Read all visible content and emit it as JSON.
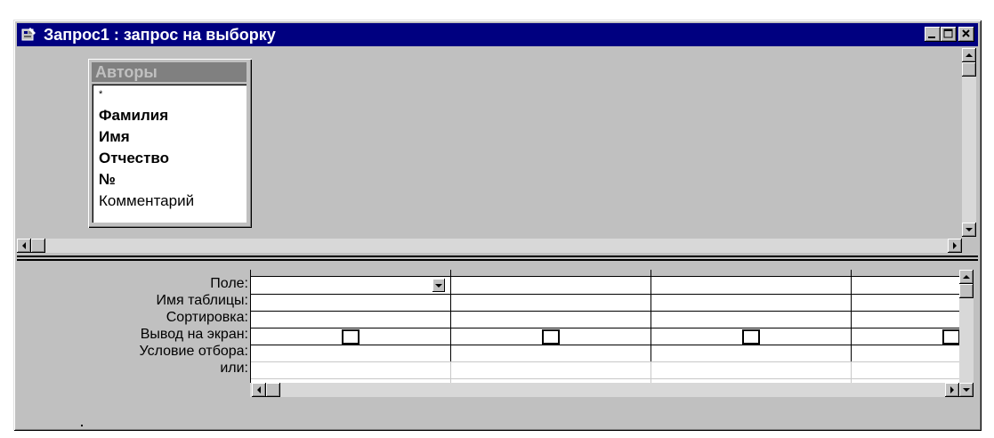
{
  "window": {
    "title": "Запрос1 : запрос на выборку",
    "controls": [
      "minimize-icon",
      "maximize-icon",
      "close-icon"
    ],
    "title_bar_color": "#000080"
  },
  "field_list": {
    "title": "Авторы",
    "items": [
      {
        "label": "*",
        "bold": false
      },
      {
        "label": "Фамилия",
        "bold": true
      },
      {
        "label": "Имя",
        "bold": true
      },
      {
        "label": "Отчество",
        "bold": true
      },
      {
        "label": "№",
        "bold": true
      },
      {
        "label": "Комментарий",
        "bold": false
      }
    ]
  },
  "query_grid": {
    "row_labels": [
      "Поле:",
      "Имя таблицы:",
      "Сортировка:",
      "Вывод на экран:",
      "Условие отбора:",
      "или:"
    ],
    "columns": [
      {
        "field": "",
        "table": "",
        "sort": "",
        "show": false,
        "criteria": "",
        "or": ""
      },
      {
        "field": "",
        "table": "",
        "sort": "",
        "show": false,
        "criteria": "",
        "or": ""
      },
      {
        "field": "",
        "table": "",
        "sort": "",
        "show": false,
        "criteria": "",
        "or": ""
      },
      {
        "field": "",
        "table": "",
        "sort": "",
        "show": false,
        "criteria": "",
        "or": ""
      }
    ]
  }
}
